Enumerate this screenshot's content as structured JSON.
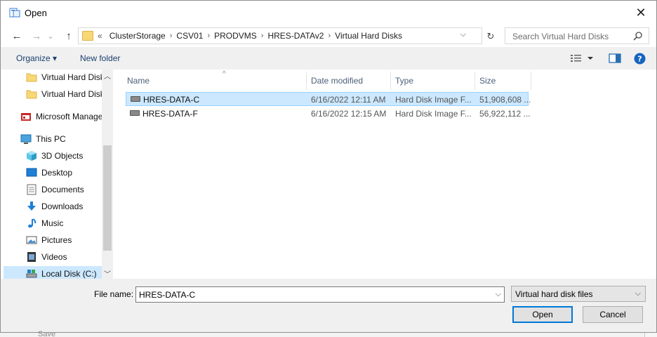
{
  "window": {
    "title": "Open",
    "close_glyph": "✕"
  },
  "nav": {
    "back_glyph": "←",
    "forward_glyph": "→",
    "recent_glyph": "⌄",
    "up_glyph": "↑",
    "breadcrumb": [
      "ClusterStorage",
      "CSV01",
      "PRODVMS",
      "HRES-DATAv2",
      "Virtual Hard Disks"
    ],
    "overflow": "«",
    "search_placeholder": "Search Virtual Hard Disks"
  },
  "toolbar": {
    "organize": "Organize ▾",
    "new_folder": "New folder"
  },
  "sidebar": {
    "items": [
      {
        "label": "Virtual Hard Disk",
        "icon": "folder-icon"
      },
      {
        "label": "Virtual Hard Disk",
        "icon": "folder-icon"
      },
      {
        "label": "Microsoft Manage",
        "icon": "mmc-icon"
      },
      {
        "label": "This PC",
        "icon": "computer-icon"
      },
      {
        "label": "3D Objects",
        "icon": "cube-icon"
      },
      {
        "label": "Desktop",
        "icon": "desktop-icon"
      },
      {
        "label": "Documents",
        "icon": "documents-icon"
      },
      {
        "label": "Downloads",
        "icon": "download-icon"
      },
      {
        "label": "Music",
        "icon": "music-icon"
      },
      {
        "label": "Pictures",
        "icon": "pictures-icon"
      },
      {
        "label": "Videos",
        "icon": "videos-icon"
      },
      {
        "label": "Local Disk (C:)",
        "icon": "drive-icon"
      }
    ]
  },
  "columns": {
    "name": "Name",
    "date": "Date modified",
    "type": "Type",
    "size": "Size"
  },
  "files": [
    {
      "name": "HRES-DATA-C",
      "date": "6/16/2022 12:11 AM",
      "type": "Hard Disk Image F...",
      "size": "51,908,608 ..."
    },
    {
      "name": "HRES-DATA-F",
      "date": "6/16/2022 12:15 AM",
      "type": "Hard Disk Image F...",
      "size": "56,922,112 ..."
    }
  ],
  "footer": {
    "file_name_label": "File name:",
    "file_name_value": "HRES-DATA-C",
    "filter_value": "Virtual hard disk files",
    "open": "Open",
    "cancel": "Cancel"
  },
  "background": {
    "save_label": "Save"
  },
  "colors": {
    "selection": "#cce8ff",
    "accent": "#0078d7"
  }
}
